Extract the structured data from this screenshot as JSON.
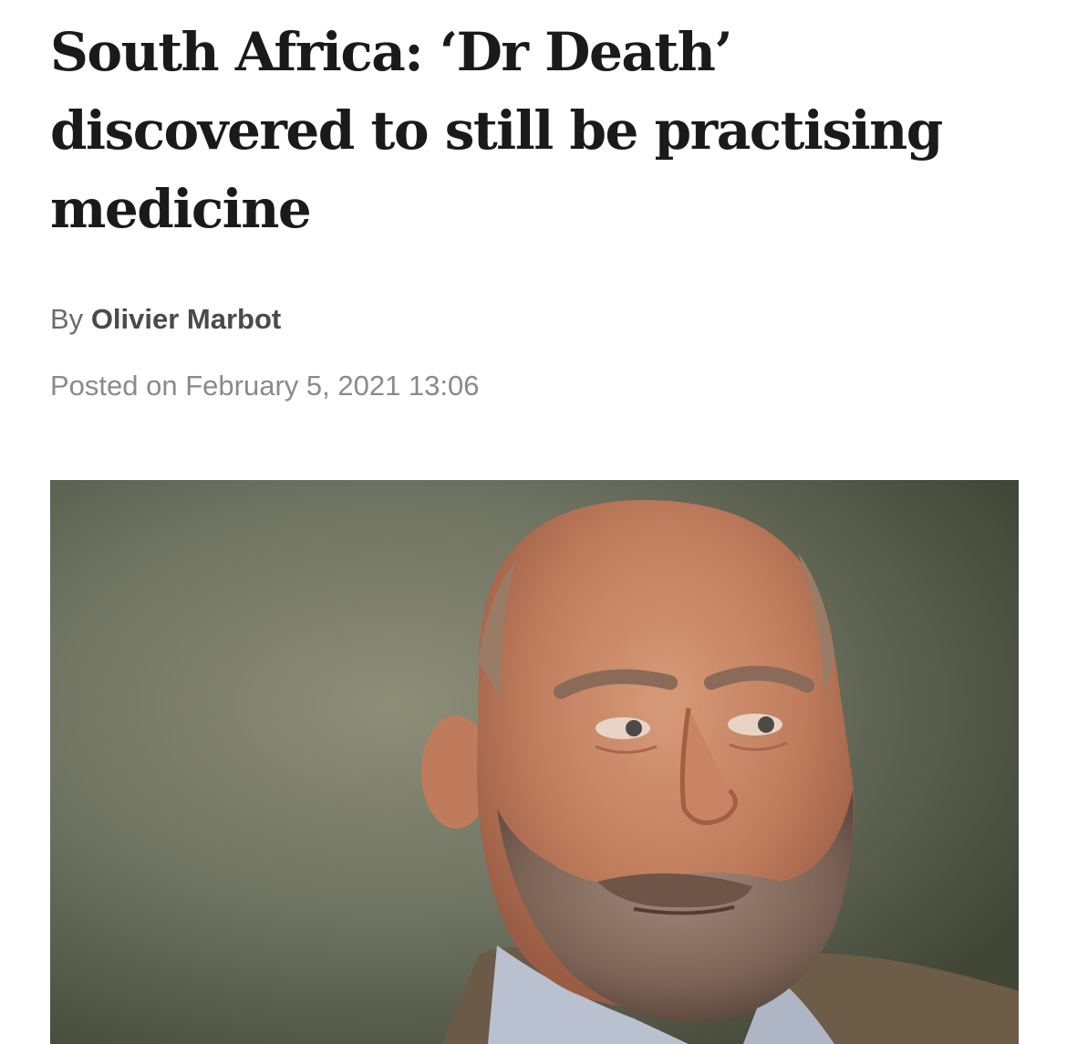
{
  "article": {
    "headline": "South Africa: ‘Dr Death’ discovered to still be practising medicine",
    "byline_prefix": "By",
    "author": "Olivier Marbot",
    "posted": "Posted on February 5, 2021 13:06"
  }
}
